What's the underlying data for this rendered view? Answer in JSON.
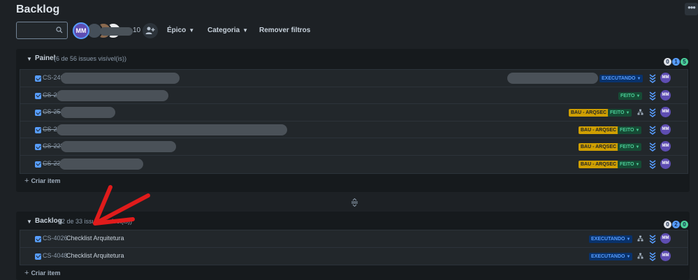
{
  "page": {
    "title": "Backlog"
  },
  "toolbar": {
    "search_placeholder": "",
    "avatar_initials": "MM",
    "avatar_extra_count": "10",
    "filters": [
      {
        "label": "Épico",
        "has_dropdown": true
      },
      {
        "label": "Categoria",
        "has_dropdown": true
      },
      {
        "label": "Remover filtros",
        "has_dropdown": false
      }
    ]
  },
  "sprint": {
    "title": "Painel",
    "subtitle": "(6 de 56 issues visível(is))",
    "counts": [
      "0",
      "1",
      "5"
    ],
    "create_label": "Criar item",
    "rows": [
      {
        "key": "CS-246",
        "done": false,
        "status": "EXECUTANDO",
        "status_color": "blue",
        "epic": "",
        "assignee": "MM"
      },
      {
        "key": "CS-25",
        "done": true,
        "status": "FEITO",
        "status_color": "green",
        "epic": "",
        "assignee": "MM"
      },
      {
        "key": "CS-251",
        "done": true,
        "status": "FEITO",
        "status_color": "green",
        "epic": "BAU - ARQSEC",
        "assignee": "MM"
      },
      {
        "key": "CS-24",
        "done": true,
        "status": "FEITO",
        "status_color": "green",
        "epic": "BAU - ARQSEC",
        "assignee": "MM"
      },
      {
        "key": "CS-228",
        "done": true,
        "status": "FEITO",
        "status_color": "green",
        "epic": "BAU - ARQSEC",
        "assignee": "MM"
      },
      {
        "key": "CS-23",
        "done": true,
        "status": "FEITO",
        "status_color": "green",
        "epic": "BAU - ARQSEC",
        "assignee": "MM"
      }
    ]
  },
  "backlog": {
    "title": "Backlog",
    "subtitle": "(2 de 33 issues visível(is))",
    "counts": [
      "0",
      "2",
      "0"
    ],
    "create_label": "Criar item",
    "rows": [
      {
        "key": "CS-4026",
        "summary": "Checklist Arquitetura",
        "status": "EXECUTANDO",
        "assignee": "MM"
      },
      {
        "key": "CS-4048",
        "summary": "Checklist Arquitetura",
        "status": "EXECUTANDO",
        "assignee": "MM"
      }
    ]
  },
  "colors": {
    "background": "#1d2125",
    "status_blue": "#579dff",
    "status_green": "#4bce97",
    "epic_yellow": "#cf9f02",
    "avatar": "#5e4db2",
    "annotation_arrow": "#e01b1b"
  },
  "icons": {
    "search": "search-icon",
    "add_people": "add-person-icon",
    "more": "more-horizontal-icon",
    "priority": "priority-lowest-icon",
    "hierarchy": "child-issues-icon",
    "resize": "drag-handle-icon"
  }
}
